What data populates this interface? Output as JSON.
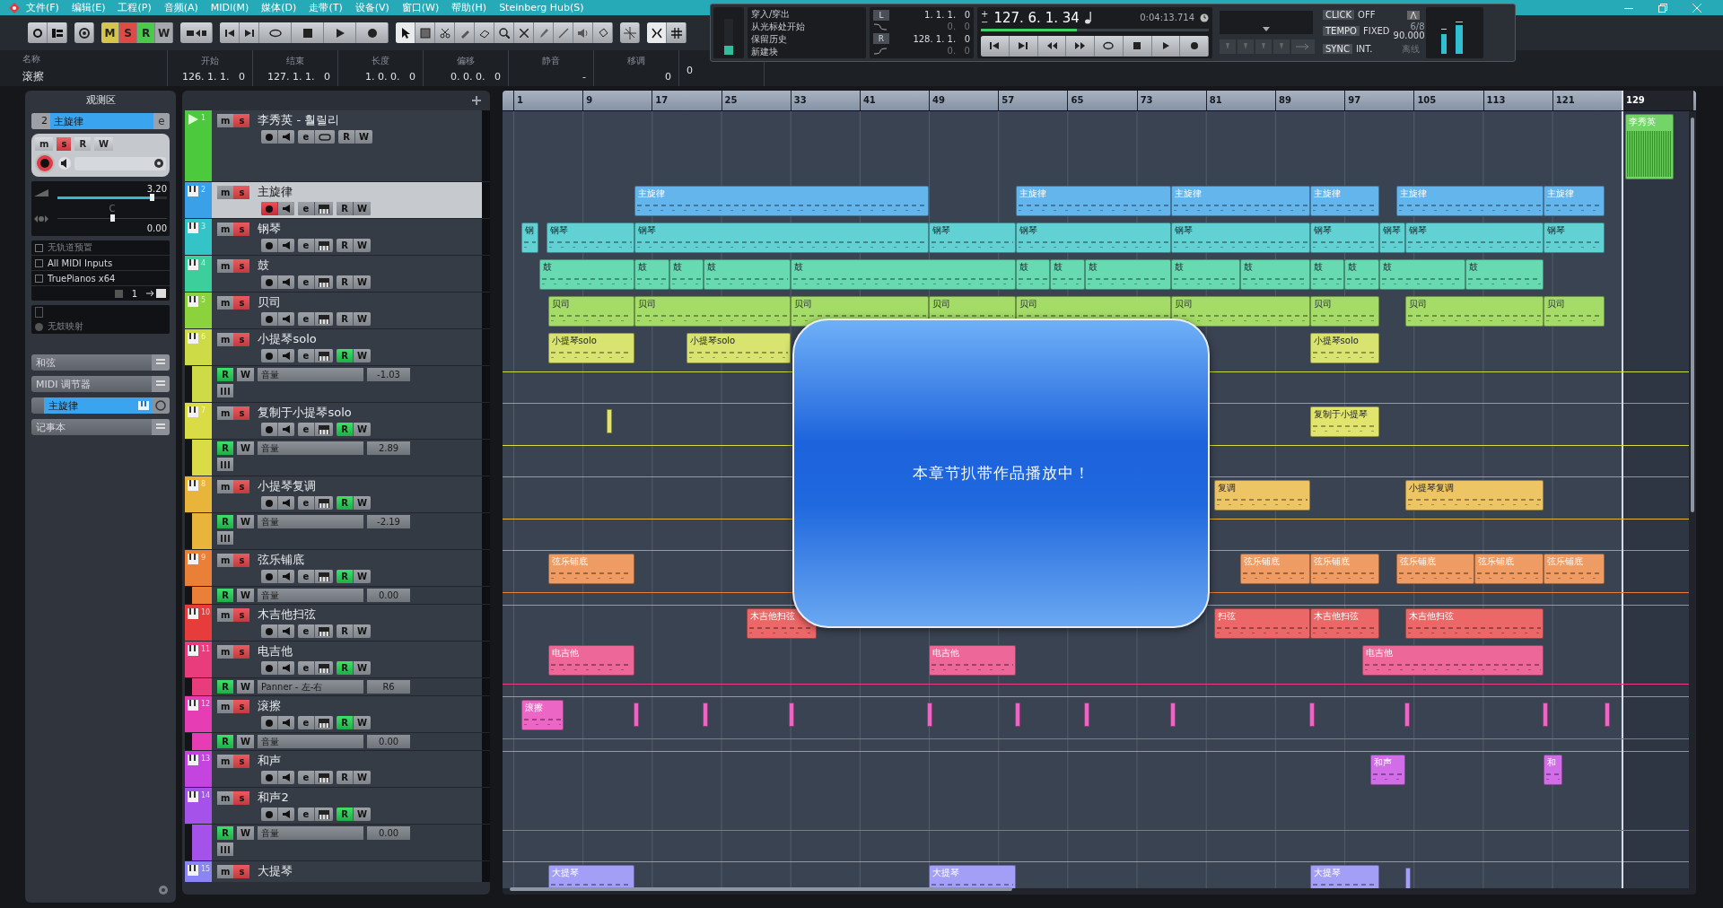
{
  "menu_bar": {
    "items": [
      "文件(F)",
      "编辑(E)",
      "工程(P)",
      "音频(A)",
      "MIDI(M)",
      "媒体(D)",
      "走带(T)",
      "设备(V)",
      "窗口(W)",
      "帮助(H)",
      "Steinberg Hub(S)"
    ]
  },
  "toolbar": {
    "mode_buttons": [
      {
        "label": "M",
        "color": "#d6c54a"
      },
      {
        "label": "S",
        "color": "#de4b47"
      },
      {
        "label": "R",
        "color": "#4cc84c"
      },
      {
        "label": "W",
        "color": "#a4a8ad"
      }
    ]
  },
  "info_line": {
    "columns": [
      {
        "label": "名称",
        "value": "滚擦"
      },
      {
        "label": "开始",
        "value": "126. 1. 1.   0"
      },
      {
        "label": "结束",
        "value": "127. 1. 1.   0"
      },
      {
        "label": "长度",
        "value": "1. 0. 0.   0"
      },
      {
        "label": "偏移",
        "value": "0. 0. 0.   0"
      },
      {
        "label": "静音",
        "value": "-"
      },
      {
        "label": "移调",
        "value": "0"
      }
    ],
    "column_8": {
      "value": "0"
    }
  },
  "transport": {
    "options": [
      "穿入/穿出",
      "从光标处开始",
      "保留历史",
      "新建块"
    ],
    "left_locator": {
      "label": "L",
      "position": "1. 1. 1.   0",
      "offset": "0.   0"
    },
    "right_locator": {
      "label": "R",
      "position": "128. 1. 1.   0",
      "offset": "0.   0"
    },
    "nudge_plus": "+",
    "nudge_minus": "−",
    "position": "127. 6. 1. 34",
    "time": "0:04:13.714",
    "scrub": {
      "level": 0.42
    },
    "click": {
      "label": "CLICK",
      "value": "OFF"
    },
    "tempo": {
      "label": "TEMPO",
      "mode": "FIXED",
      "signature": "6/8",
      "value": "90.000"
    },
    "sync": {
      "label": "SYNC",
      "value": "INT.",
      "status": "离线"
    }
  },
  "inspector": {
    "title": "观测区",
    "track_number": "2",
    "track_name": "主旋律",
    "edit_label": "e",
    "mute_label": "m",
    "solo_label": "s",
    "read_label": "R",
    "write_label": "W",
    "record_armed": true,
    "volume": {
      "reading": "3.20",
      "level": 0.86
    },
    "pan": {
      "label": "C",
      "reading": "0.00",
      "level": 0.5
    },
    "routing": [
      {
        "label": "无轨道预置",
        "disabled": true
      },
      {
        "label": "All MIDI Inputs",
        "disabled": false
      },
      {
        "label": "TruePianos x64",
        "disabled": false
      }
    ],
    "channel": "1",
    "drum_map": "无鼓映射",
    "sections": [
      {
        "kind": "section",
        "label": "和弦"
      },
      {
        "kind": "section",
        "label": "MIDI 调节器"
      },
      {
        "kind": "channel",
        "label": "主旋律"
      },
      {
        "kind": "section",
        "label": "记事本"
      }
    ]
  },
  "tracks": [
    {
      "number": "1",
      "name": "李秀英 - 훨릴리",
      "kind": "audio",
      "color": "#4cc93c",
      "selected": false,
      "record_armed": false,
      "read": false,
      "mute_label": "m",
      "solo_label": "s",
      "edit_label": "e",
      "read_label": "R",
      "write_label": "W",
      "clips": [
        {
          "label": "李秀英"
        }
      ]
    },
    {
      "number": "2",
      "name": "主旋律",
      "kind": "midi",
      "color": "#3aa0e8",
      "selected": true,
      "record_armed": true,
      "read": false,
      "mute_label": "m",
      "solo_label": "s",
      "edit_label": "e",
      "read_label": "R",
      "write_label": "W",
      "clips": [
        {
          "label": "主旋律"
        },
        {
          "label": "主旋律"
        },
        {
          "label": "主旋律"
        },
        {
          "label": "主旋律"
        },
        {
          "label": "主旋律"
        },
        {
          "label": "主旋律"
        }
      ]
    },
    {
      "number": "3",
      "name": "钢琴",
      "kind": "midi",
      "color": "#34c4c8",
      "selected": false,
      "record_armed": false,
      "read": false,
      "mute_label": "m",
      "solo_label": "s",
      "edit_label": "e",
      "read_label": "R",
      "write_label": "W",
      "clips": [
        {
          "label": "钢"
        },
        {
          "label": "钢琴"
        },
        {
          "label": "钢琴"
        },
        {
          "label": "钢琴"
        },
        {
          "label": "钢琴"
        },
        {
          "label": "钢琴"
        },
        {
          "label": "钢琴"
        },
        {
          "label": "钢琴"
        },
        {
          "label": "钢琴"
        },
        {
          "label": "钢琴"
        }
      ]
    },
    {
      "number": "4",
      "name": "鼓",
      "kind": "midi",
      "color": "#3ccf9c",
      "selected": false,
      "record_armed": false,
      "read": false,
      "mute_label": "m",
      "solo_label": "s",
      "edit_label": "e",
      "read_label": "R",
      "write_label": "W",
      "clips": [
        {
          "label": "鼓"
        },
        {
          "label": "鼓"
        },
        {
          "label": "鼓"
        },
        {
          "label": "鼓"
        },
        {
          "label": "鼓"
        },
        {
          "label": "鼓"
        },
        {
          "label": "鼓"
        },
        {
          "label": "鼓"
        },
        {
          "label": "鼓"
        },
        {
          "label": "鼓"
        },
        {
          "label": "鼓"
        },
        {
          "label": "鼓"
        },
        {
          "label": "鼓"
        },
        {
          "label": "鼓"
        }
      ]
    },
    {
      "number": "5",
      "name": "贝司",
      "kind": "midi",
      "color": "#8cd23c",
      "selected": false,
      "record_armed": false,
      "read": false,
      "mute_label": "m",
      "solo_label": "s",
      "edit_label": "e",
      "read_label": "R",
      "write_label": "W",
      "clips": [
        {
          "label": "贝司"
        },
        {
          "label": "贝司"
        },
        {
          "label": "贝司"
        },
        {
          "label": "贝司"
        },
        {
          "label": "贝司"
        },
        {
          "label": "贝司"
        },
        {
          "label": "贝司"
        },
        {
          "label": "贝司"
        },
        {
          "label": "贝司"
        }
      ]
    },
    {
      "number": "6",
      "name": "小提琴solo",
      "kind": "midi",
      "color": "#cddc46",
      "selected": false,
      "record_armed": false,
      "read": true,
      "mute_label": "m",
      "solo_label": "s",
      "edit_label": "e",
      "read_label": "R",
      "write_label": "W",
      "clips": [
        {
          "label": "小提琴solo"
        },
        {
          "label": "小提琴solo"
        },
        {
          "label": "小提琴solo"
        }
      ],
      "automation": {
        "read_label": "R",
        "write_label": "W",
        "read": true,
        "parameter": "音量",
        "value": "-1.03",
        "expanded": true
      }
    },
    {
      "number": "7",
      "name": "复制于小提琴solo",
      "kind": "midi",
      "color": "#d9dc44",
      "selected": false,
      "record_armed": false,
      "read": true,
      "mute_label": "m",
      "solo_label": "s",
      "edit_label": "e",
      "read_label": "R",
      "write_label": "W",
      "clips": [
        {
          "label": "复制于小提琴"
        }
      ],
      "automation": {
        "read_label": "R",
        "write_label": "W",
        "read": true,
        "parameter": "音量",
        "value": "2.89",
        "expanded": true
      }
    },
    {
      "number": "8",
      "name": "小提琴复调",
      "kind": "midi",
      "color": "#e8b43a",
      "selected": false,
      "record_armed": false,
      "read": true,
      "mute_label": "m",
      "solo_label": "s",
      "edit_label": "e",
      "read_label": "R",
      "write_label": "W",
      "clips": [
        {
          "label": "复调"
        },
        {
          "label": "小提琴复调"
        }
      ],
      "automation": {
        "read_label": "R",
        "write_label": "W",
        "read": true,
        "parameter": "音量",
        "value": "-2.19",
        "expanded": true
      }
    },
    {
      "number": "9",
      "name": "弦乐铺底",
      "kind": "midi",
      "color": "#ea7f38",
      "selected": false,
      "record_armed": false,
      "read": true,
      "mute_label": "m",
      "solo_label": "s",
      "edit_label": "e",
      "read_label": "R",
      "write_label": "W",
      "clips": [
        {
          "label": "弦乐铺底"
        },
        {
          "label": "弦乐铺底"
        },
        {
          "label": "弦乐铺底"
        },
        {
          "label": "弦乐铺底"
        },
        {
          "label": "弦乐铺底"
        },
        {
          "label": "弦乐铺底"
        }
      ],
      "automation": {
        "read_label": "R",
        "write_label": "W",
        "read": true,
        "parameter": "音量",
        "value": "0.00",
        "expanded": false
      }
    },
    {
      "number": "10",
      "name": "木吉他扫弦",
      "kind": "midi",
      "color": "#e63c3c",
      "selected": false,
      "record_armed": false,
      "read": false,
      "mute_label": "m",
      "solo_label": "s",
      "edit_label": "e",
      "read_label": "R",
      "write_label": "W",
      "clips": [
        {
          "label": "木吉他扫弦"
        },
        {
          "label": "扫弦"
        },
        {
          "label": "木吉他扫弦"
        },
        {
          "label": "木吉他扫弦"
        }
      ]
    },
    {
      "number": "11",
      "name": "电吉他",
      "kind": "midi",
      "color": "#e83c7c",
      "selected": false,
      "record_armed": false,
      "read": true,
      "mute_label": "m",
      "solo_label": "s",
      "edit_label": "e",
      "read_label": "R",
      "write_label": "W",
      "clips": [
        {
          "label": "电吉他"
        },
        {
          "label": "电吉他"
        },
        {
          "label": "电吉他"
        }
      ],
      "automation": {
        "read_label": "R",
        "write_label": "W",
        "read": true,
        "parameter": "Panner - 左-右",
        "value": "R6",
        "expanded": false
      }
    },
    {
      "number": "12",
      "name": "滚擦",
      "kind": "midi",
      "color": "#e63cb4",
      "selected": false,
      "record_armed": false,
      "read": true,
      "mute_label": "m",
      "solo_label": "s",
      "edit_label": "e",
      "read_label": "R",
      "write_label": "W",
      "clips": [
        {
          "label": "滚擦"
        }
      ],
      "automation": {
        "read_label": "R",
        "write_label": "W",
        "read": true,
        "parameter": "音量",
        "value": "0.00",
        "expanded": false
      }
    },
    {
      "number": "13",
      "name": "和声",
      "kind": "midi",
      "color": "#c444e0",
      "selected": false,
      "record_armed": false,
      "read": false,
      "mute_label": "m",
      "solo_label": "s",
      "edit_label": "e",
      "read_label": "R",
      "write_label": "W",
      "clips": [
        {
          "label": "和声"
        },
        {
          "label": "和"
        }
      ]
    },
    {
      "number": "14",
      "name": "和声2",
      "kind": "midi",
      "color": "#a452ea",
      "selected": false,
      "record_armed": false,
      "read": true,
      "mute_label": "m",
      "solo_label": "s",
      "edit_label": "e",
      "read_label": "R",
      "write_label": "W",
      "automation": {
        "read_label": "R",
        "write_label": "W",
        "read": true,
        "parameter": "音量",
        "value": "0.00",
        "expanded": true
      }
    },
    {
      "number": "15",
      "name": "大提琴",
      "kind": "midi",
      "color": "#8a84f4",
      "selected": false,
      "mute_label": "m",
      "solo_label": "s",
      "clips": [
        {
          "label": "大提琴"
        },
        {
          "label": "大提琴"
        },
        {
          "label": "大提琴"
        }
      ]
    }
  ],
  "ruler": [
    "1",
    "9",
    "17",
    "25",
    "33",
    "41",
    "49",
    "57",
    "65",
    "73",
    "81",
    "89",
    "97",
    "105",
    "113",
    "121",
    "129"
  ],
  "dialog": {
    "message": "本章节扒带作品播放中！"
  }
}
